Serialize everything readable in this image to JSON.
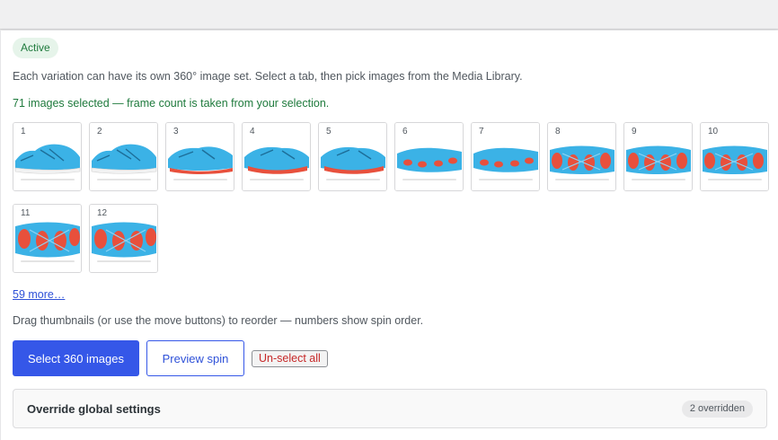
{
  "status_badge": "Active",
  "description": "Each variation can have its own 360° image set. Select a tab, then pick images from the Media Library.",
  "selection_note": "71 images selected — frame count is taken from your selection.",
  "thumbnails": [
    {
      "number": "1",
      "view": "side"
    },
    {
      "number": "2",
      "view": "side"
    },
    {
      "number": "3",
      "view": "side-angle"
    },
    {
      "number": "4",
      "view": "angle"
    },
    {
      "number": "5",
      "view": "angle"
    },
    {
      "number": "6",
      "view": "sole-angle"
    },
    {
      "number": "7",
      "view": "sole-angle"
    },
    {
      "number": "8",
      "view": "sole"
    },
    {
      "number": "9",
      "view": "sole"
    },
    {
      "number": "10",
      "view": "sole"
    },
    {
      "number": "11",
      "view": "sole-top"
    },
    {
      "number": "12",
      "view": "sole-top"
    }
  ],
  "more_link": "59 more…",
  "reorder_hint": "Drag thumbnails (or use the move buttons) to reorder — numbers show spin order.",
  "buttons": {
    "select": "Select 360 images",
    "preview": "Preview spin",
    "unselect": "Un-select all"
  },
  "override": {
    "title": "Override global settings",
    "count": "2 overridden"
  },
  "colors": {
    "accent": "#3557e8",
    "success": "#1e7a3c",
    "danger": "#c62828",
    "shoe_blue": "#3bb2e6",
    "sole_red": "#e8503c"
  }
}
